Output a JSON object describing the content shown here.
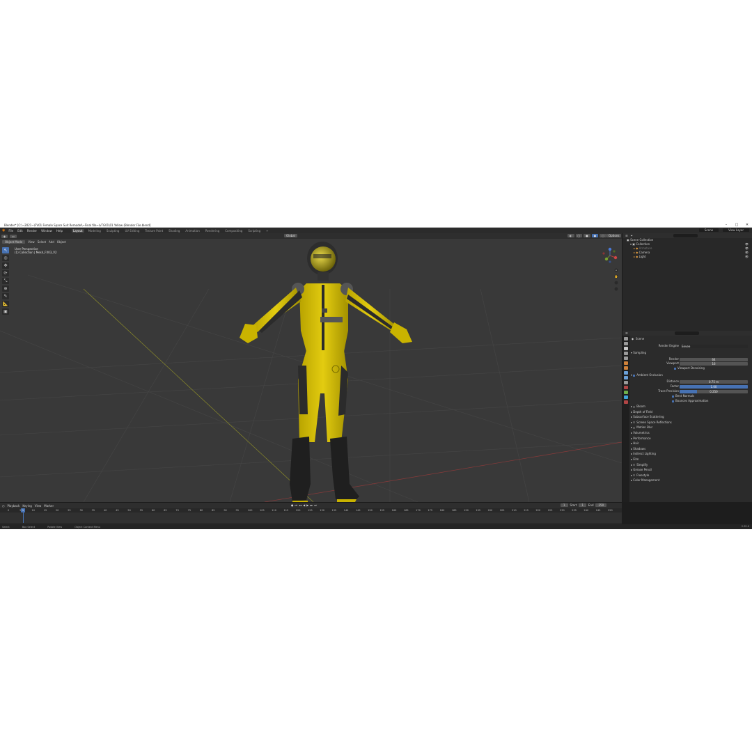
{
  "window": {
    "title": "Blender* [C:\\~2021~\\FV01 Female Space Suit Remodel\\~Final file~\\vTG01\\01 Yellow (Blender File.blend]",
    "controls": [
      "–",
      "□",
      "✕"
    ]
  },
  "menubar": {
    "menus": [
      "File",
      "Edit",
      "Render",
      "Window",
      "Help"
    ],
    "workspaces": [
      "Layout",
      "Modeling",
      "Sculpting",
      "UV Editing",
      "Texture Paint",
      "Shading",
      "Animation",
      "Rendering",
      "Compositing",
      "Scripting"
    ],
    "active_workspace": "Layout",
    "scene": "Scene",
    "view_layer": "View Layer"
  },
  "viewport": {
    "mode": "Object Mode",
    "menus": [
      "View",
      "Select",
      "Add",
      "Object"
    ],
    "orientation": "Global",
    "options": "Options",
    "info_line1": "User Perspective",
    "info_line2": "(1) Collection | Mesh_FX03_V2"
  },
  "toolbar": {
    "tools": [
      {
        "icon": "select-cursor-icon",
        "glyph": "↖",
        "active": true
      },
      {
        "icon": "cursor-icon",
        "glyph": "◎",
        "active": false
      },
      {
        "icon": "move-icon",
        "glyph": "✥",
        "active": false
      },
      {
        "icon": "rotate-icon",
        "glyph": "⟳",
        "active": false
      },
      {
        "icon": "scale-icon",
        "glyph": "⤡",
        "active": false
      },
      {
        "icon": "transform-icon",
        "glyph": "⊕",
        "active": false
      },
      {
        "icon": "annotate-icon",
        "glyph": "✎",
        "active": false
      },
      {
        "icon": "measure-icon",
        "glyph": "📐",
        "active": false
      },
      {
        "icon": "add-cube-icon",
        "glyph": "▣",
        "active": false
      }
    ]
  },
  "outliner": {
    "rows": [
      {
        "label": "Scene Collection",
        "indent": 0,
        "dim": false
      },
      {
        "label": "Collection",
        "indent": 1,
        "dim": false
      },
      {
        "label": "Armature",
        "indent": 2,
        "dim": true
      },
      {
        "label": "Camera",
        "indent": 2,
        "dim": false
      },
      {
        "label": "Light",
        "indent": 2,
        "dim": false
      }
    ]
  },
  "properties": {
    "context": "Scene",
    "render_engine_label": "Render Engine",
    "render_engine": "Eevee",
    "sampling": {
      "title": "Sampling",
      "render_label": "Render",
      "render": "64",
      "viewport_label": "Viewport",
      "viewport": "16",
      "denoise": "Viewport Denoising"
    },
    "ao": {
      "title": "Ambient Occlusion",
      "distance_label": "Distance",
      "distance": "0.75 m",
      "factor_label": "Factor",
      "factor": "1.00",
      "factor_fill": 1.0,
      "precision_label": "Trace Precision",
      "precision": "0.250",
      "precision_fill": 0.25,
      "bent_normals": "Bent Normals",
      "bounces": "Bounces Approximation"
    },
    "panels": [
      "Bloom",
      "Depth of Field",
      "Subsurface Scattering",
      "Screen Space Reflections",
      "Motion Blur",
      "Volumetrics",
      "Performance",
      "Hair",
      "Shadows",
      "Indirect Lighting",
      "Film",
      "Simplify",
      "Grease Pencil",
      "Freestyle",
      "Color Management"
    ],
    "panels_with_check": [
      "Bloom",
      "Screen Space Reflections",
      "Motion Blur",
      "Simplify",
      "Freestyle"
    ]
  },
  "timeline": {
    "menus": [
      "Playback",
      "Keying",
      "View",
      "Marker"
    ],
    "current_frame": "1",
    "start_label": "Start",
    "start": "1",
    "end_label": "End",
    "end": "250",
    "ticks": [
      "0",
      "5",
      "10",
      "15",
      "20",
      "25",
      "30",
      "35",
      "40",
      "45",
      "50",
      "55",
      "60",
      "65",
      "70",
      "75",
      "80",
      "85",
      "90",
      "95",
      "100",
      "105",
      "110",
      "115",
      "120",
      "125",
      "130",
      "135",
      "140",
      "145",
      "150",
      "155",
      "160",
      "165",
      "170",
      "175",
      "180",
      "185",
      "190",
      "195",
      "200",
      "205",
      "210",
      "215",
      "220",
      "225",
      "230",
      "235",
      "240",
      "245",
      "250"
    ]
  },
  "statusbar": {
    "items": [
      "Select",
      "Box Select",
      "Rotate View",
      "Object Context Menu"
    ],
    "version": "2.92.0"
  }
}
